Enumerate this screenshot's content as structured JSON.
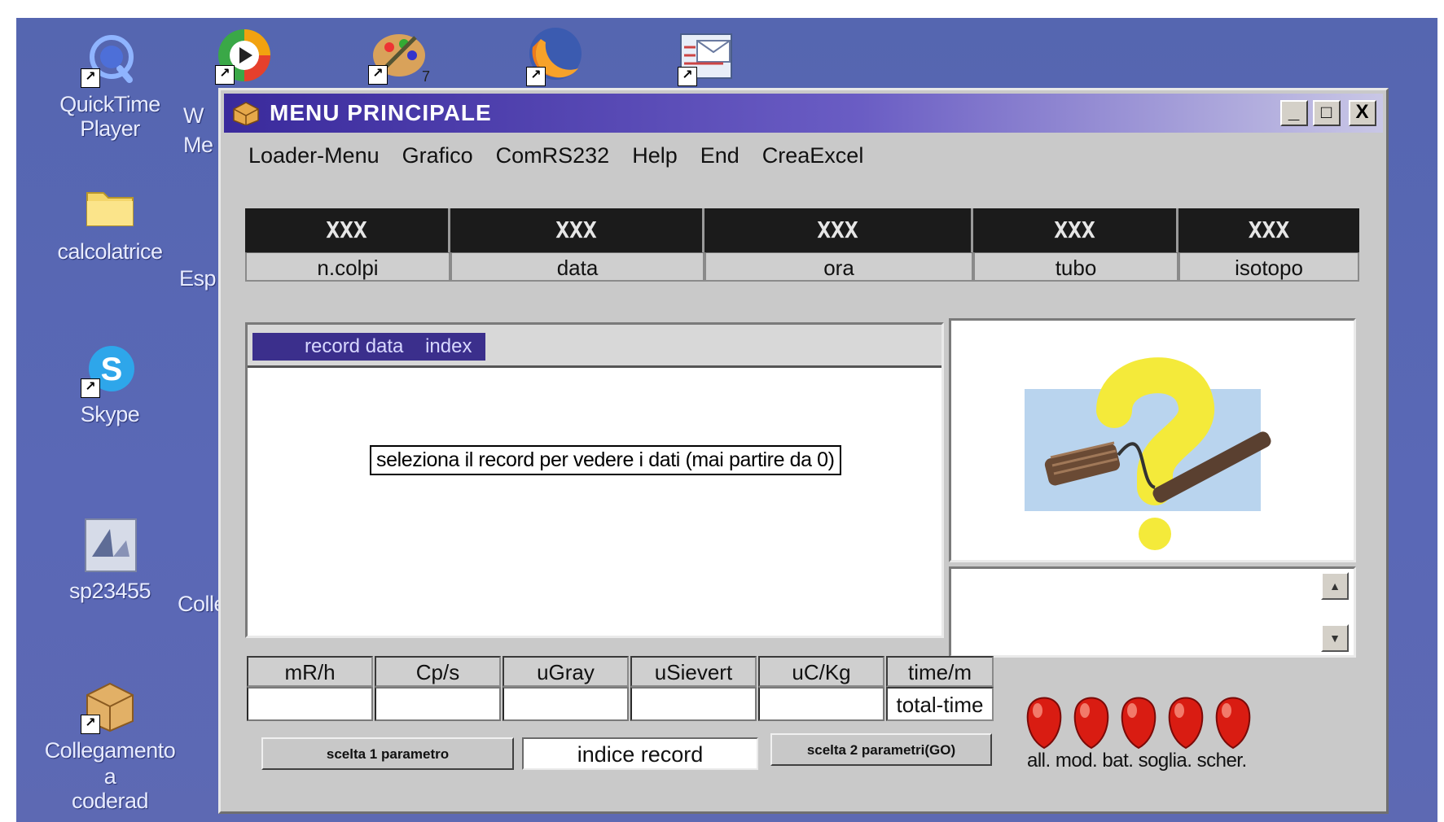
{
  "desktop": {
    "icons_left": [
      {
        "label_line1": "QuickTime",
        "label_line2": "Player",
        "icon": "quicktime-icon"
      },
      {
        "label_line1": "calcolatrice",
        "label_line2": "",
        "icon": "folder-icon"
      },
      {
        "label_line1": "Skype",
        "label_line2": "",
        "icon": "skype-icon"
      },
      {
        "label_line1": "sp23455",
        "label_line2": "",
        "icon": "app-icon"
      },
      {
        "label_line1": "Collegamento a",
        "label_line2": "coderad",
        "icon": "package-icon"
      }
    ],
    "partial_labels": [
      "W",
      "Me",
      "Esp",
      "Colle"
    ],
    "top_badge": "7"
  },
  "window": {
    "title": "MENU PRINCIPALE",
    "buttons": {
      "minimize": "_",
      "maximize": "□",
      "close": "X"
    },
    "menu": [
      "Loader-Menu",
      "Grafico",
      "ComRS232",
      "Help",
      "End",
      "CreaExcel"
    ],
    "header": {
      "values": [
        "XXX",
        "XXX",
        "XXX",
        "XXX",
        "XXX"
      ],
      "labels": [
        "n.colpi",
        "data",
        "ora",
        "tubo",
        "isotopo"
      ]
    },
    "record_header": "record data    index",
    "record_hint": "seleziona il record per vedere i dati (mai partire da 0)",
    "units": [
      "mR/h",
      "Cp/s",
      "uGray",
      "uSievert",
      "uC/Kg"
    ],
    "time_label": "time/m",
    "total_time_label": "total-time",
    "btn_param1": "scelta 1 parametro",
    "record_index": "indice record",
    "btn_param2": "scelta 2 parametri(GO)",
    "led_labels": "all. mod. bat. soglia. scher."
  }
}
